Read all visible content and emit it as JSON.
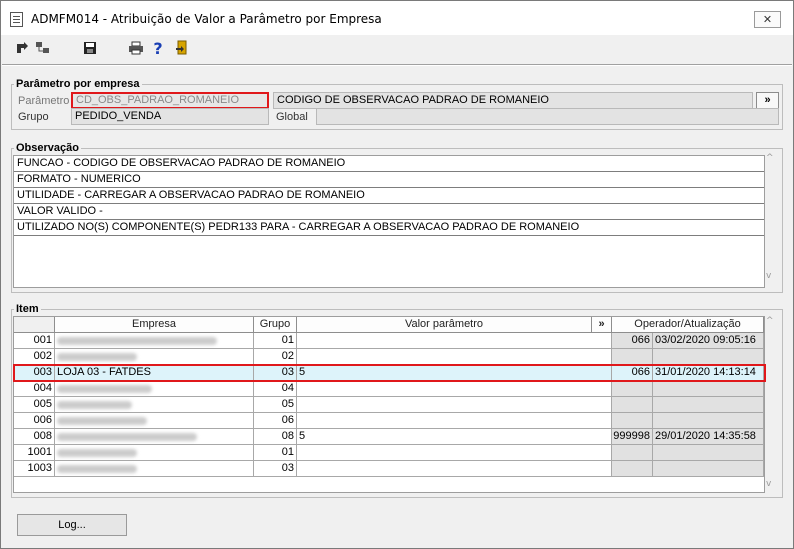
{
  "window": {
    "title": "ADMFM014 - Atribuição de Valor a Parâmetro por Empresa",
    "close_glyph": "✕"
  },
  "toolbar": {
    "icons": [
      "arrow-left-icon",
      "tree-icon",
      "save-icon",
      "print-icon",
      "help-icon",
      "exit-door-icon"
    ],
    "help_glyph": "?"
  },
  "parametro_section": {
    "legend": "Parâmetro por empresa",
    "parametro_label": "Parâmetro",
    "parametro_value": "CD_OBS_PADRAO_ROMANEIO",
    "parametro_desc": "CODIGO DE OBSERVACAO PADRAO DE ROMANEIO",
    "more_button": "»",
    "grupo_label": "Grupo",
    "grupo_value": "PEDIDO_VENDA",
    "global_label": "Global",
    "global_value": ""
  },
  "observacao_section": {
    "legend": "Observação",
    "lines": [
      "FUNCAO - CODIGO DE OBSERVACAO PADRAO DE ROMANEIO",
      "FORMATO - NUMERICO",
      "UTILIDADE - CARREGAR A OBSERVACAO PADRAO DE ROMANEIO",
      "VALOR VALIDO -",
      "UTILIZADO NO(S) COMPONENTE(S) PEDR133  PARA  - CARREGAR A OBSERVACAO PADRAO DE ROMANEIO"
    ]
  },
  "item_section": {
    "legend": "Item",
    "columns": {
      "empresa": "Empresa",
      "grupo": "Grupo",
      "valor": "Valor parâmetro",
      "more": "»",
      "operador": "Operador/Atualização"
    },
    "rows": [
      {
        "codigo": "001",
        "empresa": "",
        "grupo": "01",
        "valor": "",
        "operador": "066",
        "atualizacao": "03/02/2020 09:05:16",
        "selected": false
      },
      {
        "codigo": "002",
        "empresa": "",
        "grupo": "02",
        "valor": "",
        "operador": "",
        "atualizacao": "",
        "selected": false
      },
      {
        "codigo": "003",
        "empresa": "LOJA 03 - FATDES",
        "grupo": "03",
        "valor": "5",
        "operador": "066",
        "atualizacao": "31/01/2020 14:13:14",
        "selected": true
      },
      {
        "codigo": "004",
        "empresa": "",
        "grupo": "04",
        "valor": "",
        "operador": "",
        "atualizacao": "",
        "selected": false
      },
      {
        "codigo": "005",
        "empresa": "",
        "grupo": "05",
        "valor": "",
        "operador": "",
        "atualizacao": "",
        "selected": false
      },
      {
        "codigo": "006",
        "empresa": "",
        "grupo": "06",
        "valor": "",
        "operador": "",
        "atualizacao": "",
        "selected": false
      },
      {
        "codigo": "008",
        "empresa": "",
        "grupo": "08",
        "valor": "5",
        "operador": "999998",
        "atualizacao": "29/01/2020 14:35:58",
        "selected": false
      },
      {
        "codigo": "1001",
        "empresa": "",
        "grupo": "01",
        "valor": "",
        "operador": "",
        "atualizacao": "",
        "selected": false
      },
      {
        "codigo": "1003",
        "empresa": "",
        "grupo": "03",
        "valor": "",
        "operador": "",
        "atualizacao": "",
        "selected": false
      }
    ]
  },
  "footer": {
    "log_button": "Log..."
  }
}
